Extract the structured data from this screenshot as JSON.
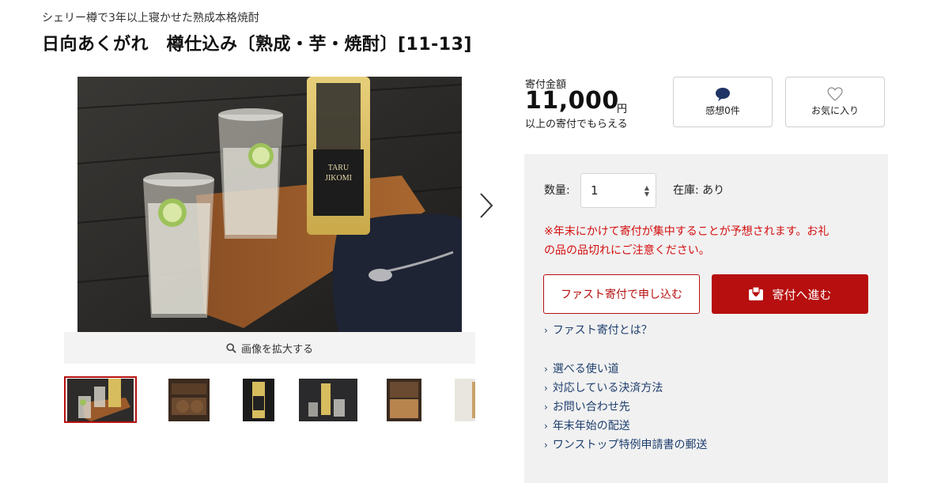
{
  "product": {
    "subtitle": "シェリー樽で3年以上寝かせた熟成本格焼酎",
    "title": "日向あくがれ　樽仕込み〔熟成・芋・焼酎〕[11-13]"
  },
  "gallery": {
    "zoom_label": "画像を拡大する",
    "icons": {
      "zoom": "magnifier-icon",
      "next": "chevron-right-icon"
    }
  },
  "price": {
    "label": "寄付金額",
    "amount": "11,000",
    "unit": "円",
    "note": "以上の寄付でもらえる"
  },
  "actions": {
    "reviews_label": "感想0件",
    "favorite_label": "お気に入り",
    "icons": {
      "reviews": "speech-bubble-icon",
      "favorite": "heart-icon"
    }
  },
  "order": {
    "quantity_label": "数量:",
    "quantity_value": "1",
    "stock_label": "在庫: あり",
    "notice_line1": "※年末にかけて寄付が集中することが予想されます。お礼",
    "notice_line2": "の品の品切れにご注意ください。",
    "fast_button": "ファスト寄付で申し込む",
    "donate_button": "寄付へ進む",
    "accent_color": "#b70f0f"
  },
  "links": {
    "fast_about": "ファスト寄付とは？",
    "items": [
      "選べる使い道",
      "対応している決済方法",
      "お問い合わせ先",
      "年末年始の配送",
      "ワンストップ特例申請書の郵送"
    ]
  }
}
